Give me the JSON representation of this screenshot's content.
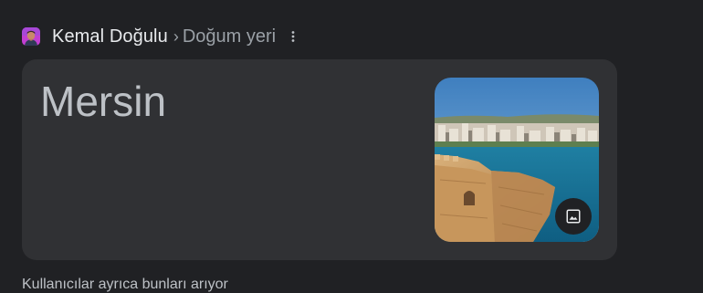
{
  "breadcrumb": {
    "entity": "Kemal Doğulu",
    "separator": "›",
    "attribute": "Doğum yeri"
  },
  "answer": {
    "value": "Mersin"
  },
  "thumbnail": {
    "icon": "image-icon"
  },
  "footer_text": "Kullanıcılar ayrıca bunları arıyor",
  "colors": {
    "background": "#202124",
    "card": "#303134",
    "answer_text": "#bdc1c6",
    "secondary_text": "#9aa0a6"
  }
}
